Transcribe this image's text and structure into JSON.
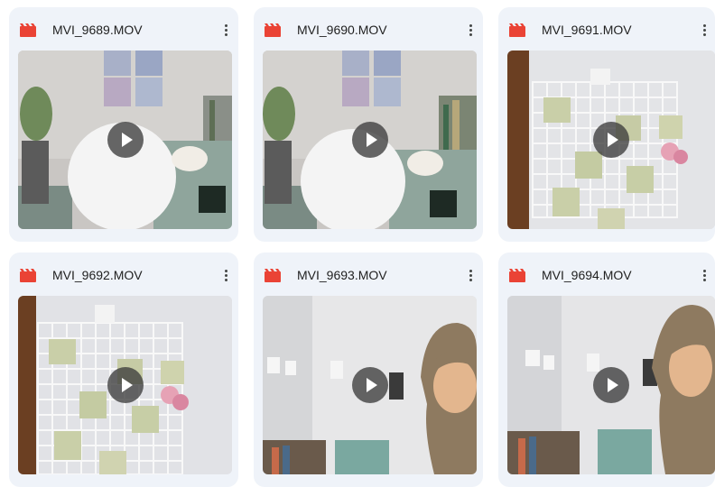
{
  "files": [
    {
      "name": "MVI_9689.MOV",
      "scene": "lamp"
    },
    {
      "name": "MVI_9690.MOV",
      "scene": "lamp"
    },
    {
      "name": "MVI_9691.MOV",
      "scene": "grid"
    },
    {
      "name": "MVI_9692.MOV",
      "scene": "grid"
    },
    {
      "name": "MVI_9693.MOV",
      "scene": "person"
    },
    {
      "name": "MVI_9694.MOV",
      "scene": "person"
    }
  ],
  "colors": {
    "card_bg": "#eff3f9",
    "video_icon": "#ea4335",
    "text": "#1f1f1f",
    "play_button": "rgba(60,60,60,0.78)"
  },
  "icons": {
    "file_type": "video-file-icon",
    "menu": "more-vert-icon",
    "play": "play-icon"
  }
}
